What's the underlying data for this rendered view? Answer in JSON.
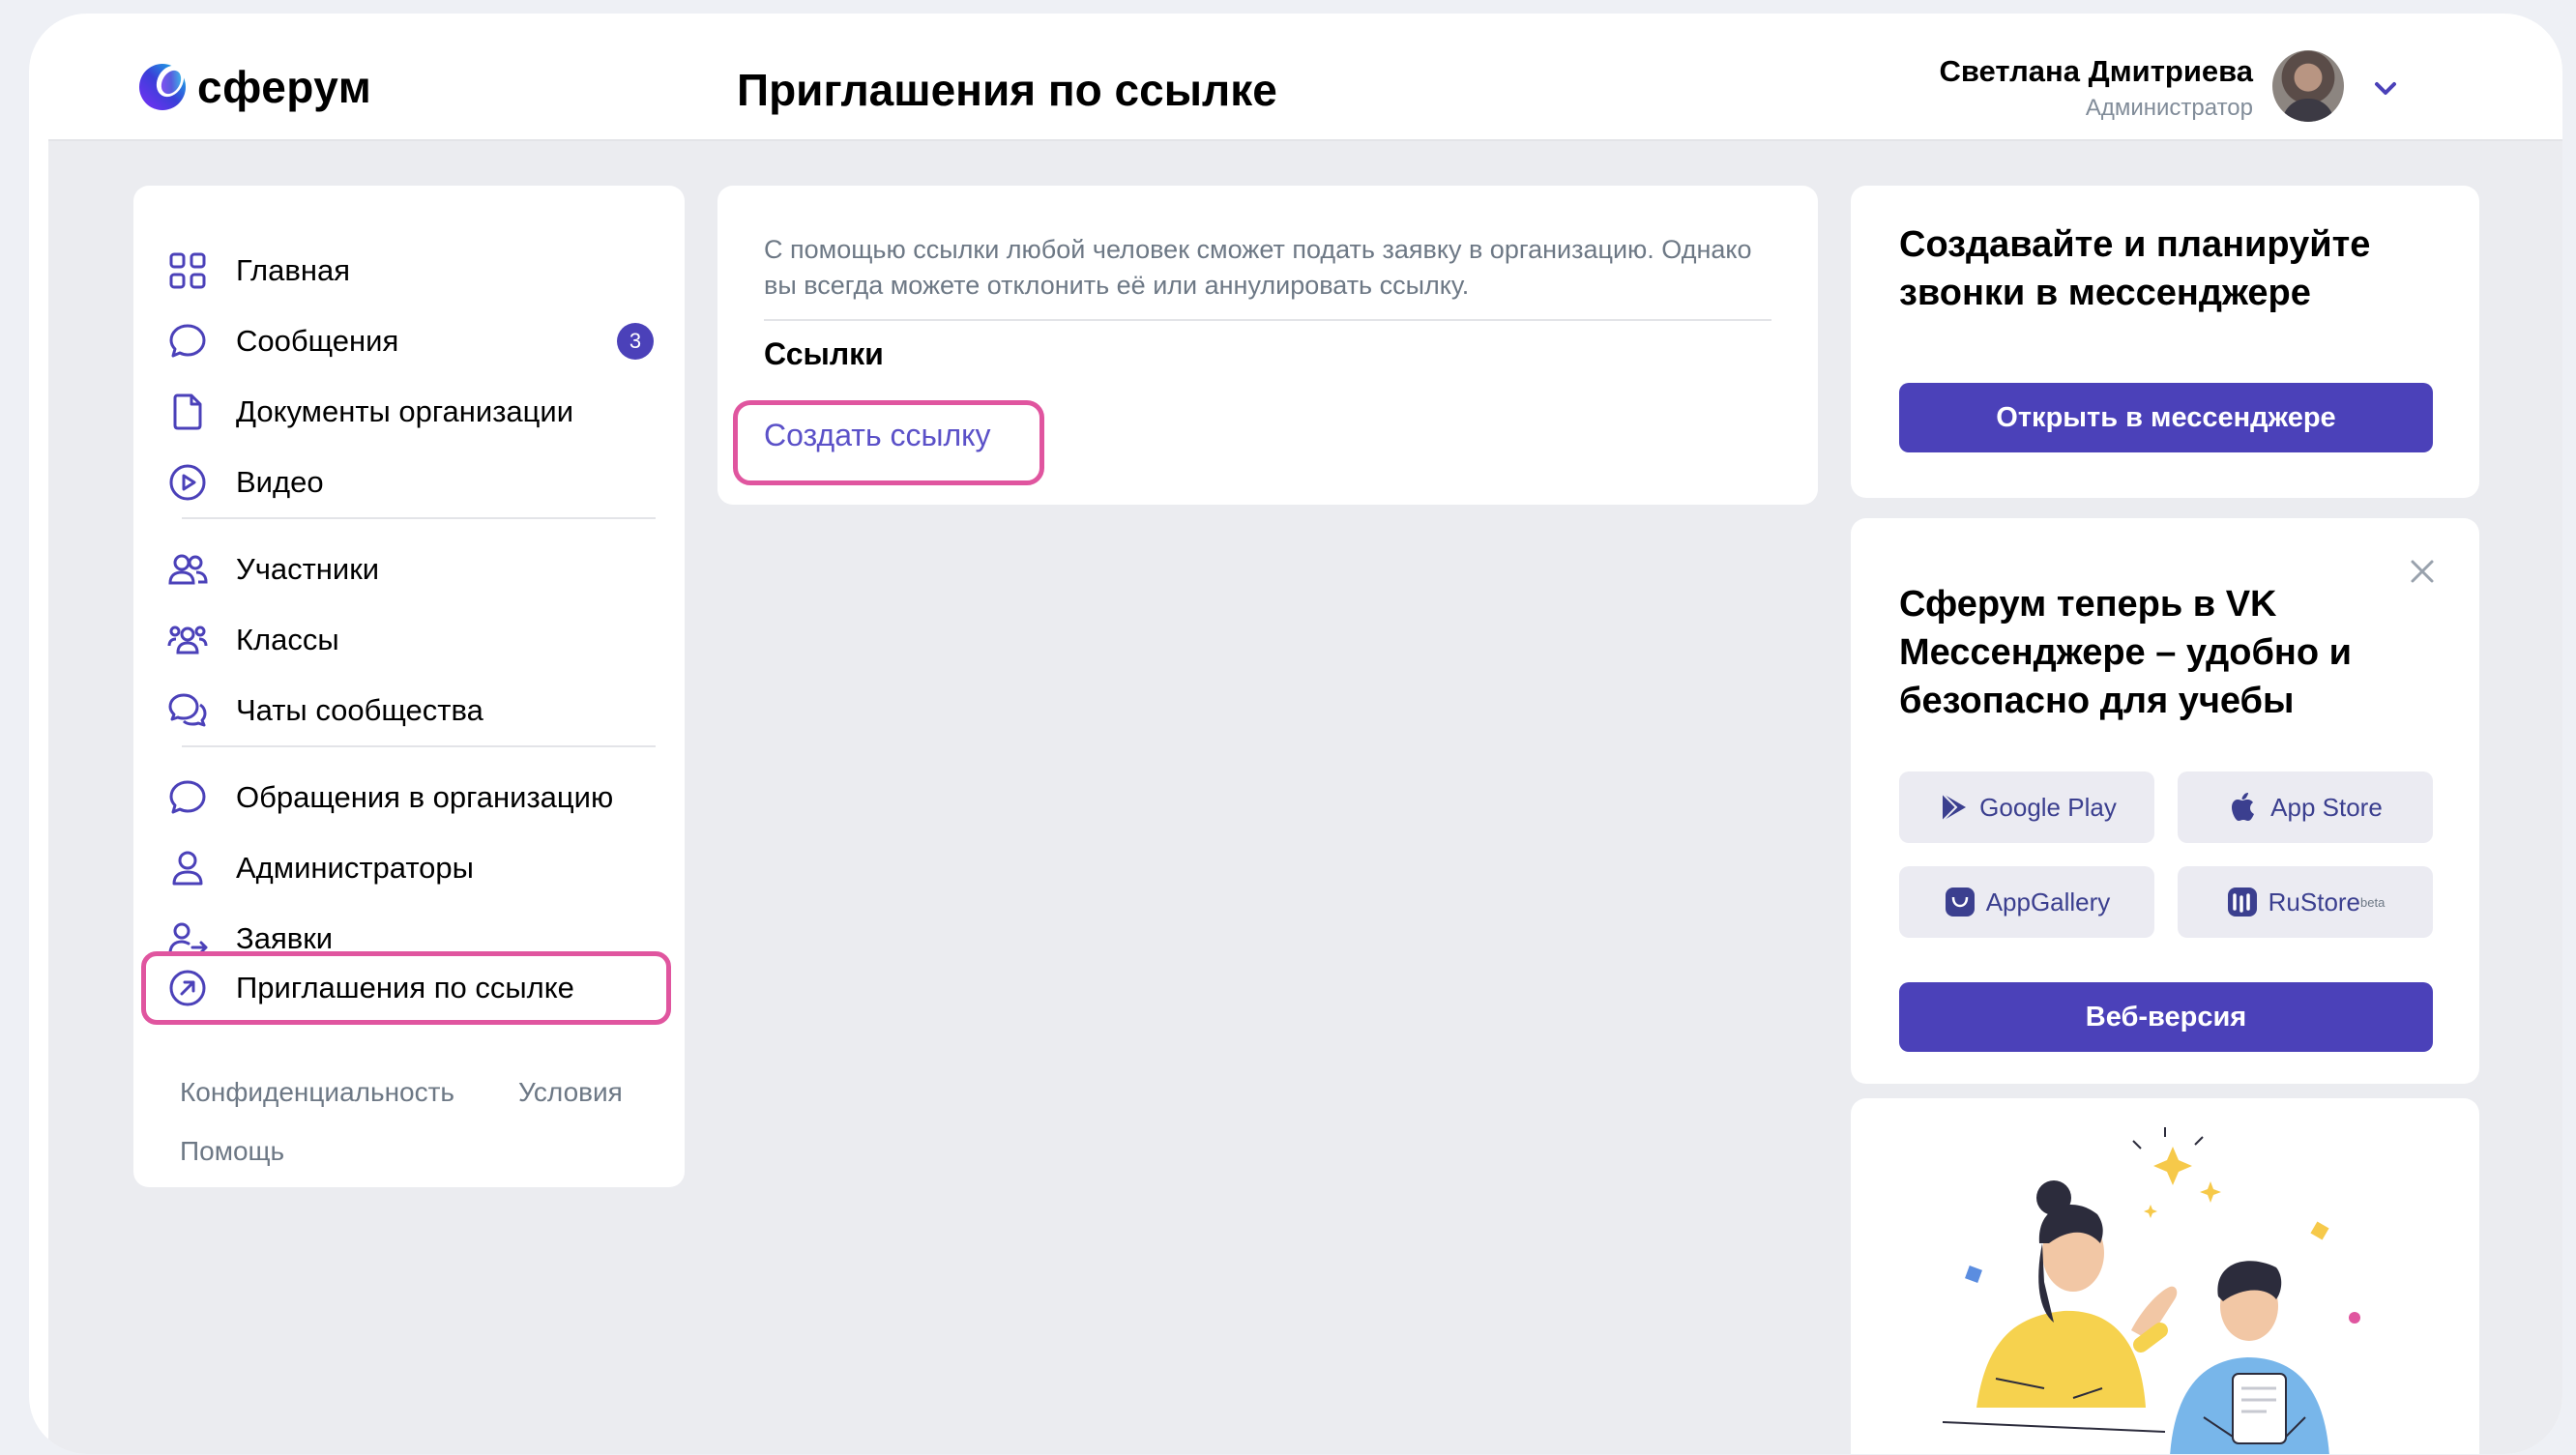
{
  "app": {
    "logo_text": "сферум",
    "page_title": "Приглашения по ссылке"
  },
  "user": {
    "name": "Светлана Дмитриева",
    "role": "Администратор"
  },
  "sidebar": {
    "items": [
      {
        "label": "Главная",
        "icon": "grid-icon"
      },
      {
        "label": "Сообщения",
        "icon": "chat-icon",
        "badge": "3"
      },
      {
        "label": "Документы организации",
        "icon": "document-icon"
      },
      {
        "label": "Видео",
        "icon": "play-icon"
      },
      {
        "label": "Участники",
        "icon": "users-icon"
      },
      {
        "label": "Классы",
        "icon": "groups-icon"
      },
      {
        "label": "Чаты сообщества",
        "icon": "chats-icon"
      },
      {
        "label": "Обращения в организацию",
        "icon": "message-icon"
      },
      {
        "label": "Администраторы",
        "icon": "person-icon"
      },
      {
        "label": "Заявки",
        "icon": "person-arrow-icon"
      },
      {
        "label": "Приглашения по ссылке",
        "icon": "arrow-circle-icon",
        "active": true
      }
    ],
    "footer": {
      "privacy": "Конфиденциальность",
      "terms": "Условия",
      "help": "Помощь"
    }
  },
  "main": {
    "description": "С помощью ссылки любой человек сможет подать заявку в организацию. Однако вы всегда можете отклонить её или аннулировать ссылку.",
    "section_title": "Ссылки",
    "create_link": "Создать ссылку"
  },
  "promo_calls": {
    "title": "Создавайте и планируйте звонки в мессенджере",
    "button": "Открыть в мессенджере"
  },
  "promo_messenger": {
    "title": "Сферум теперь в VK Мессенджере – удобно и безопасно для учебы",
    "stores": {
      "google_play": "Google Play",
      "app_store": "App Store",
      "app_gallery": "AppGallery",
      "rustore": "RuStore",
      "rustore_sup": "beta"
    },
    "web_button": "Веб-версия"
  },
  "colors": {
    "accent": "#4b41b9",
    "highlight": "#e0559f",
    "link": "#5b51c8",
    "background": "#ebecf0"
  }
}
